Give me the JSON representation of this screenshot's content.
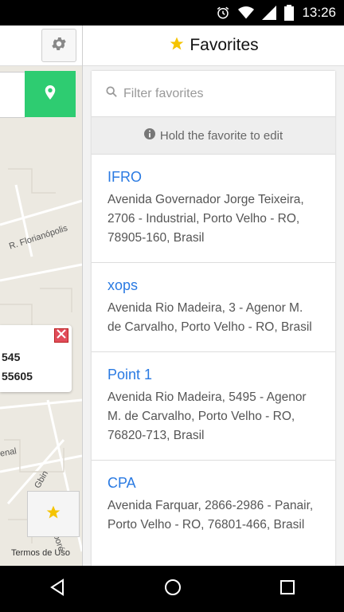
{
  "status_bar": {
    "time": "13:26"
  },
  "map": {
    "streets": [
      "R. Florianópolis",
      "enal",
      "R. Gbin",
      "Av. Guaporé"
    ],
    "info_lines": [
      "545",
      "55605"
    ],
    "terms_label": "Termos de Uso"
  },
  "panel": {
    "title": "Favorites",
    "filter_placeholder": "Filter favorites",
    "hint": "Hold the favorite to edit",
    "favorites": [
      {
        "name": "IFRO",
        "address": "Avenida Governador Jorge Teixeira, 2706 - Industrial, Porto Velho - RO, 78905-160, Brasil"
      },
      {
        "name": "xops",
        "address": "Avenida Rio Madeira, 3 - Agenor M. de Carvalho, Porto Velho - RO, Brasil"
      },
      {
        "name": "Point 1",
        "address": "Avenida Rio Madeira, 5495 - Agenor M. de Carvalho, Porto Velho - RO, 76820-713, Brasil"
      },
      {
        "name": "CPA",
        "address": "Avenida Farquar, 2866-2986 - Panair, Porto Velho - RO, 76801-466, Brasil"
      }
    ]
  },
  "colors": {
    "accent_green": "#2ecc71",
    "link_blue": "#2a7ae2",
    "star_yellow": "#f5c400"
  }
}
